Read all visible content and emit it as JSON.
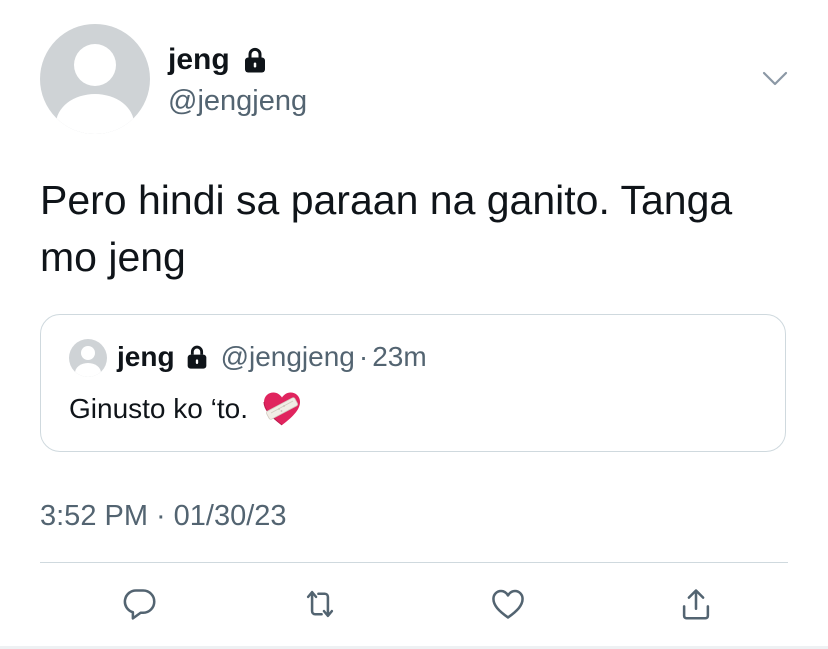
{
  "tweet": {
    "author": {
      "display_name": "jeng",
      "handle": "@jengjeng",
      "avatar_icon": "default-avatar-icon",
      "protected_icon": "lock-icon"
    },
    "text": "Pero hindi sa paraan na ganito. Tanga mo jeng",
    "quoted": {
      "display_name": "jeng",
      "handle": "@jengjeng",
      "separator": "·",
      "time": "23m",
      "text": "Ginusto ko ‘to.",
      "emoji_icon": "mending-heart-icon"
    },
    "time": "3:52 PM",
    "separator": "·",
    "date": "01/30/23"
  },
  "actions": [
    {
      "name": "reply",
      "icon": "reply-icon"
    },
    {
      "name": "retweet",
      "icon": "retweet-icon"
    },
    {
      "name": "like",
      "icon": "heart-outline-icon"
    },
    {
      "name": "share",
      "icon": "share-icon"
    }
  ],
  "colors": {
    "text_primary": "#0f1419",
    "text_secondary": "#536471",
    "border": "#cfd9de",
    "avatar_gray": "#cfd3d6"
  }
}
